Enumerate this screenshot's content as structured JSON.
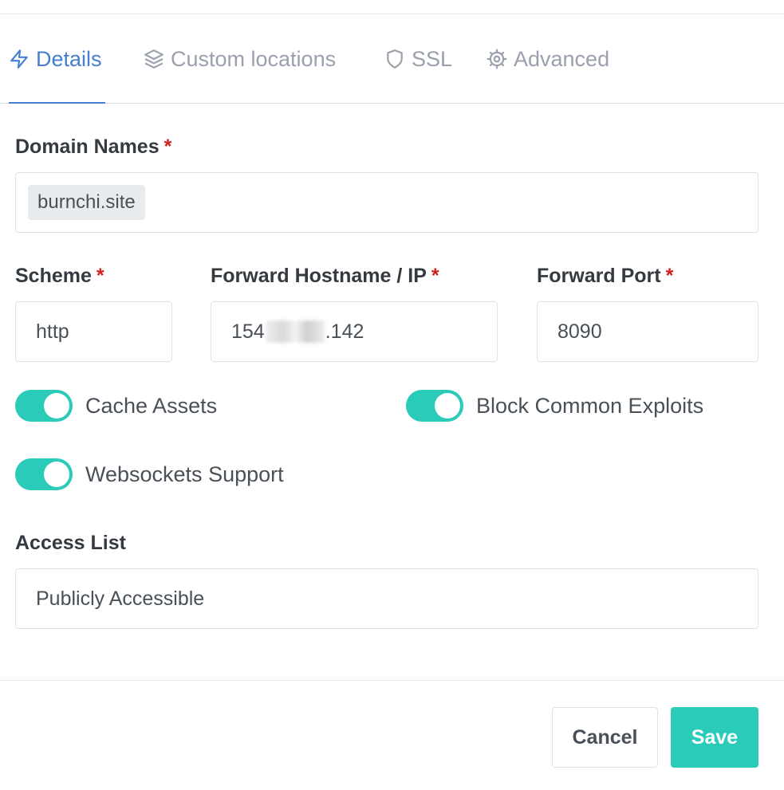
{
  "tabs": [
    {
      "label": "Details",
      "icon": "lightning-icon",
      "active": true
    },
    {
      "label": "Custom locations",
      "icon": "layers-icon",
      "active": false
    },
    {
      "label": "SSL",
      "icon": "shield-icon",
      "active": false
    },
    {
      "label": "Advanced",
      "icon": "gear-icon",
      "active": false
    }
  ],
  "form": {
    "domain_names": {
      "label": "Domain Names",
      "required_mark": "*",
      "tags": [
        "burnchi.site"
      ]
    },
    "scheme": {
      "label": "Scheme",
      "required_mark": "*",
      "value": "http"
    },
    "forward_host": {
      "label": "Forward Hostname / IP",
      "required_mark": "*",
      "value_prefix": "154",
      "value_suffix": ".142",
      "value_obscured": true
    },
    "forward_port": {
      "label": "Forward Port",
      "required_mark": "*",
      "value": "8090"
    },
    "toggles": [
      {
        "label": "Cache Assets",
        "on": true
      },
      {
        "label": "Block Common Exploits",
        "on": true
      },
      {
        "label": "Websockets Support",
        "on": true
      }
    ],
    "access_list": {
      "label": "Access List",
      "value": "Publicly Accessible"
    }
  },
  "footer": {
    "cancel_label": "Cancel",
    "save_label": "Save"
  },
  "colors": {
    "accent": "#467fcf",
    "toggle_on": "#2bcbba",
    "save_button": "#2bcbba",
    "required": "#cd201f",
    "muted_tab": "#9aa0ac"
  }
}
